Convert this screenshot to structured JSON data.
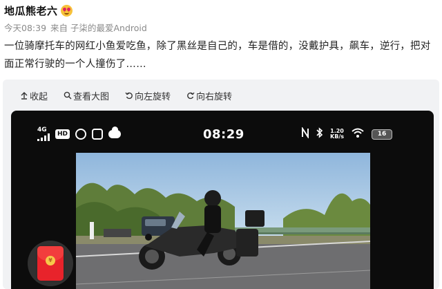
{
  "post": {
    "username": "地瓜熊老六",
    "emoji": "heart-eyes-emoji",
    "time": "今天08:39",
    "source": "来自 子柒的最爱Android",
    "body": "一位骑摩托车的网红小鱼爱吃鱼，除了黑丝是自己的，车是借的，没戴护具，飙车，逆行，把对面正常行驶的一个人撞伤了……"
  },
  "toolbar": {
    "collapse": "收起",
    "view_large": "查看大图",
    "rotate_left": "向左旋转",
    "rotate_right": "向右旋转"
  },
  "phone_status": {
    "network": "4G",
    "hd": "HD",
    "time": "08:29",
    "speed_value": "1.20",
    "speed_unit": "KB/s",
    "battery": "16"
  },
  "colors": {
    "accent_red": "#e8232b",
    "meta_gray": "#8a8a8a",
    "panel_bg": "#f1f2f4"
  }
}
